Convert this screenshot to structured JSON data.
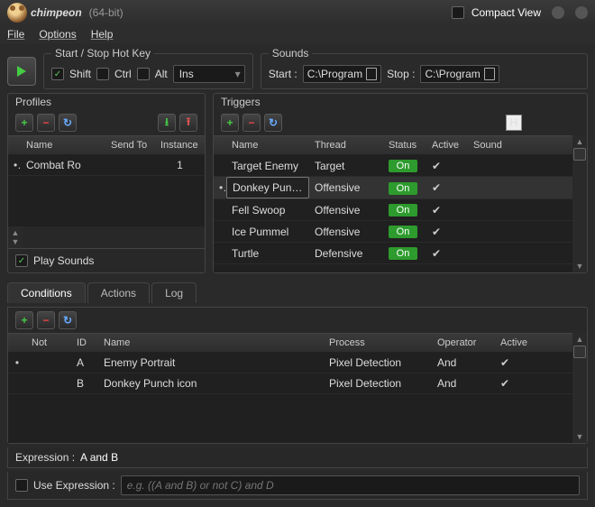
{
  "titlebar": {
    "app": "chimpeon",
    "bit": "(64-bit)",
    "compact": "Compact View"
  },
  "menu": {
    "file": "File",
    "options": "Options",
    "help": "Help"
  },
  "hotkey": {
    "legend": "Start / Stop Hot Key",
    "shift": "Shift",
    "ctrl": "Ctrl",
    "alt": "Alt",
    "key": "Ins"
  },
  "sounds": {
    "legend": "Sounds",
    "start_label": "Start :",
    "start_path": "C:\\Program",
    "stop_label": "Stop :",
    "stop_path": "C:\\Program"
  },
  "profiles": {
    "title": "Profiles",
    "cols": {
      "name": "Name",
      "sendto": "Send To",
      "instance": "Instance"
    },
    "rows": [
      {
        "name": "Combat Ro",
        "sendto": "",
        "instance": "1"
      }
    ],
    "play_sounds": "Play Sounds"
  },
  "triggers": {
    "title": "Triggers",
    "h_label": "H",
    "cols": {
      "name": "Name",
      "thread": "Thread",
      "status": "Status",
      "active": "Active",
      "sound": "Sound"
    },
    "rows": [
      {
        "name": "Target Enemy",
        "thread": "Target",
        "status": "On",
        "active": true,
        "sel": false
      },
      {
        "name": "Donkey Punch",
        "thread": "Offensive",
        "status": "On",
        "active": true,
        "sel": true
      },
      {
        "name": "Fell Swoop",
        "thread": "Offensive",
        "status": "On",
        "active": true,
        "sel": false
      },
      {
        "name": "Ice Pummel",
        "thread": "Offensive",
        "status": "On",
        "active": true,
        "sel": false
      },
      {
        "name": "Turtle",
        "thread": "Defensive",
        "status": "On",
        "active": true,
        "sel": false
      }
    ]
  },
  "tabs": {
    "conditions": "Conditions",
    "actions": "Actions",
    "log": "Log"
  },
  "conditions": {
    "cols": {
      "not": "Not",
      "id": "ID",
      "name": "Name",
      "process": "Process",
      "operator": "Operator",
      "active": "Active"
    },
    "rows": [
      {
        "not": "",
        "id": "A",
        "name": "Enemy Portrait",
        "process": "Pixel Detection",
        "operator": "And",
        "active": true
      },
      {
        "not": "",
        "id": "B",
        "name": "Donkey Punch icon",
        "process": "Pixel Detection",
        "operator": "And",
        "active": true
      }
    ]
  },
  "expression": {
    "label": "Expression :",
    "value": "A and B",
    "use": "Use Expression :",
    "placeholder": "e.g. ((A and B) or not C) and D"
  }
}
